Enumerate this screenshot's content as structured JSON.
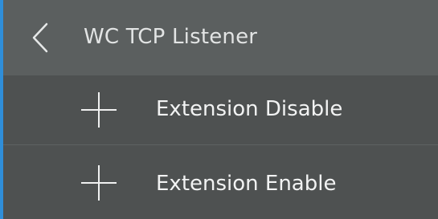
{
  "header": {
    "title": "WC TCP Listener",
    "back_icon": "chevron-left-icon"
  },
  "menu": {
    "items": [
      {
        "label": "Extension Disable",
        "icon": "plus-icon"
      },
      {
        "label": "Extension Enable",
        "icon": "plus-icon"
      }
    ]
  },
  "colors": {
    "header_bg": "#5b5f5f",
    "list_bg": "#4e5151",
    "accent": "#2f8ed9",
    "text": "#f2f3f3"
  }
}
